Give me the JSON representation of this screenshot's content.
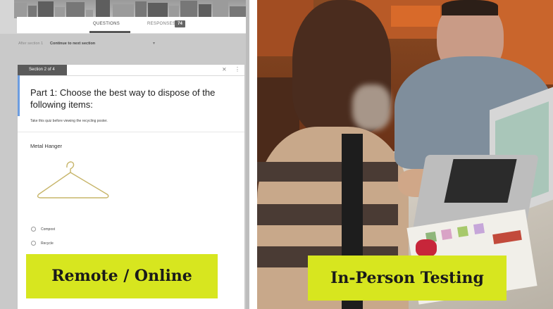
{
  "form": {
    "tabs": {
      "questions_label": "QUESTIONS",
      "responses_label": "RESPONSES",
      "responses_count": "74"
    },
    "after_section": {
      "label": "After section 1",
      "value": "Continue to next section"
    },
    "section": {
      "badge": "Section 2 of 4",
      "title": "Part 1: Choose the best way to dispose of the following items:",
      "description": "Take this quiz before viewing the recycling poster.",
      "question": {
        "title": "Metal Hanger",
        "options": [
          "Compost",
          "Recycle"
        ]
      }
    }
  },
  "labels": {
    "left": "Remote / Online",
    "right": "In-Person Testing"
  },
  "colors": {
    "label_background": "#d7e61f",
    "section_badge": "#5a5a5a",
    "accent": "#6c9de0"
  },
  "icons": {
    "collapse": "collapse-icon",
    "more": "more-vert-icon",
    "dropdown": "dropdown-caret-icon"
  }
}
